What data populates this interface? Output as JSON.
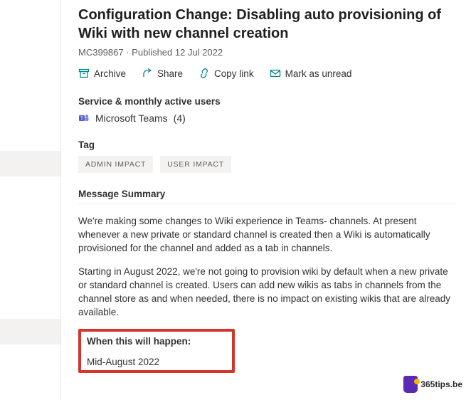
{
  "header": {
    "title": "Configuration Change: Disabling auto provisioning of Wiki with new channel creation",
    "id": "MC399867",
    "sep": " · ",
    "published_prefix": "Published ",
    "published_date": "12 Jul 2022"
  },
  "actions": {
    "archive": "Archive",
    "share": "Share",
    "copy_link": "Copy link",
    "mark_unread": "Mark as unread"
  },
  "service": {
    "label": "Service & monthly active users",
    "name": "Microsoft Teams",
    "count": "(4)"
  },
  "tag": {
    "label": "Tag",
    "items": [
      "ADMIN IMPACT",
      "USER IMPACT"
    ]
  },
  "summary": {
    "label": "Message Summary",
    "p1": "We're making some changes to Wiki experience in Teams- channels. At present whenever a new private or standard channel is created then a Wiki is automatically provisioned for the channel and added as a tab in channels.",
    "p2": "Starting in August 2022, we're not going to provision wiki by default when a new private or standard channel is created. Users can add new wikis as tabs in channels from the channel store as and when needed, there is no impact on existing wikis that are already available."
  },
  "when": {
    "heading": "When this will happen:",
    "value": "Mid-August 2022"
  },
  "branding": {
    "site": "365tips.be"
  }
}
